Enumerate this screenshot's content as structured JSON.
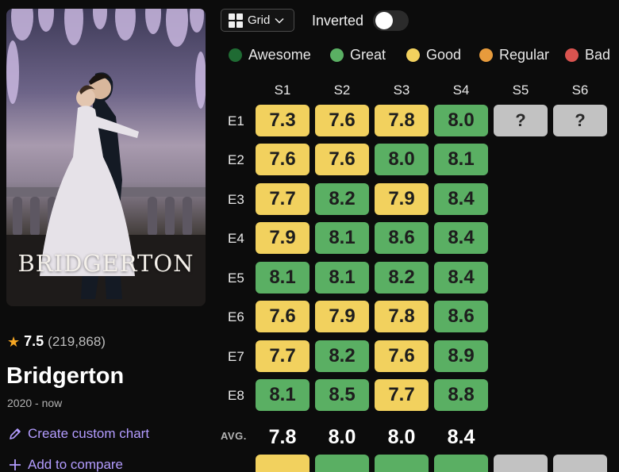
{
  "poster": {
    "title": "BRIDGERTON"
  },
  "info": {
    "rating": "7.5",
    "votes": "(219,868)",
    "title": "Bridgerton",
    "years": "2020 - now",
    "create_chart": "Create custom chart",
    "add_compare": "Add to compare"
  },
  "toolbar": {
    "view_mode": "Grid",
    "inverted_label": "Inverted",
    "inverted_on": false
  },
  "legend": [
    {
      "label": "Awesome",
      "color": "#1f6b33"
    },
    {
      "label": "Great",
      "color": "#5aaf63"
    },
    {
      "label": "Good",
      "color": "#f2d15e"
    },
    {
      "label": "Regular",
      "color": "#e79b3c"
    },
    {
      "label": "Bad",
      "color": "#d9534f"
    }
  ],
  "grid": {
    "seasons": [
      "S1",
      "S2",
      "S3",
      "S4",
      "S5",
      "S6"
    ],
    "episodes": [
      "E1",
      "E2",
      "E3",
      "E4",
      "E5",
      "E6",
      "E7",
      "E8"
    ],
    "ratings": [
      [
        "7.3",
        "7.6",
        "7.8",
        "8.0"
      ],
      [
        "7.6",
        "7.6",
        "8.0",
        "8.1"
      ],
      [
        "7.7",
        "8.2",
        "7.9",
        "8.4"
      ],
      [
        "7.9",
        "8.1",
        "8.6",
        "8.4"
      ],
      [
        "8.1",
        "8.1",
        "8.2",
        "8.4"
      ],
      [
        "7.6",
        "7.9",
        "7.8",
        "8.6"
      ],
      [
        "7.7",
        "8.2",
        "7.6",
        "8.9"
      ],
      [
        "8.1",
        "8.5",
        "7.7",
        "8.8"
      ]
    ],
    "unknown_label": "?",
    "avg_label": "AVG.",
    "averages": [
      "7.8",
      "8.0",
      "8.0",
      "8.4"
    ],
    "colors": {
      "good": "#f2d15e",
      "great": "#5aaf63",
      "unknown": "#c2c2c2"
    }
  }
}
